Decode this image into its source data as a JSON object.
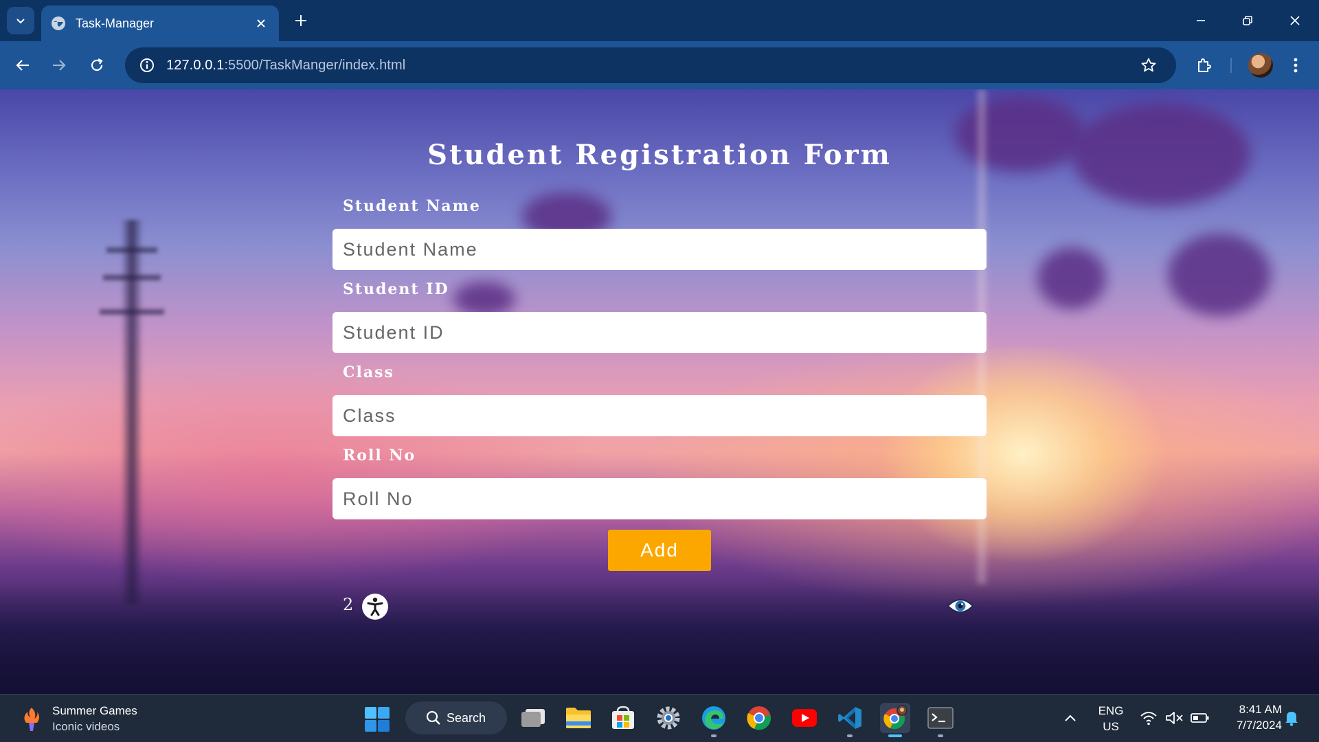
{
  "browser": {
    "tab_title": "Task-Manager",
    "url_host": "127.0.0.1",
    "url_path": ":5500/TaskManger/index.html"
  },
  "form": {
    "title": "Student Registration Form",
    "fields": [
      {
        "label": "Student Name",
        "placeholder": "Student Name"
      },
      {
        "label": "Student ID",
        "placeholder": "Student ID"
      },
      {
        "label": "Class",
        "placeholder": "Class"
      },
      {
        "label": "Roll No",
        "placeholder": "Roll No"
      }
    ],
    "add_label": "Add",
    "count": "2"
  },
  "taskbar": {
    "widget_title": "Summer Games",
    "widget_subtitle": "Iconic videos",
    "search_label": "Search",
    "lang_line1": "ENG",
    "lang_line2": "US",
    "time": "8:41 AM",
    "date": "7/7/2024"
  },
  "colors": {
    "chrome_dark": "#0d3363",
    "chrome_light": "#1d5597",
    "add_button": "#fca700",
    "taskbar": "#1f2a3a"
  }
}
